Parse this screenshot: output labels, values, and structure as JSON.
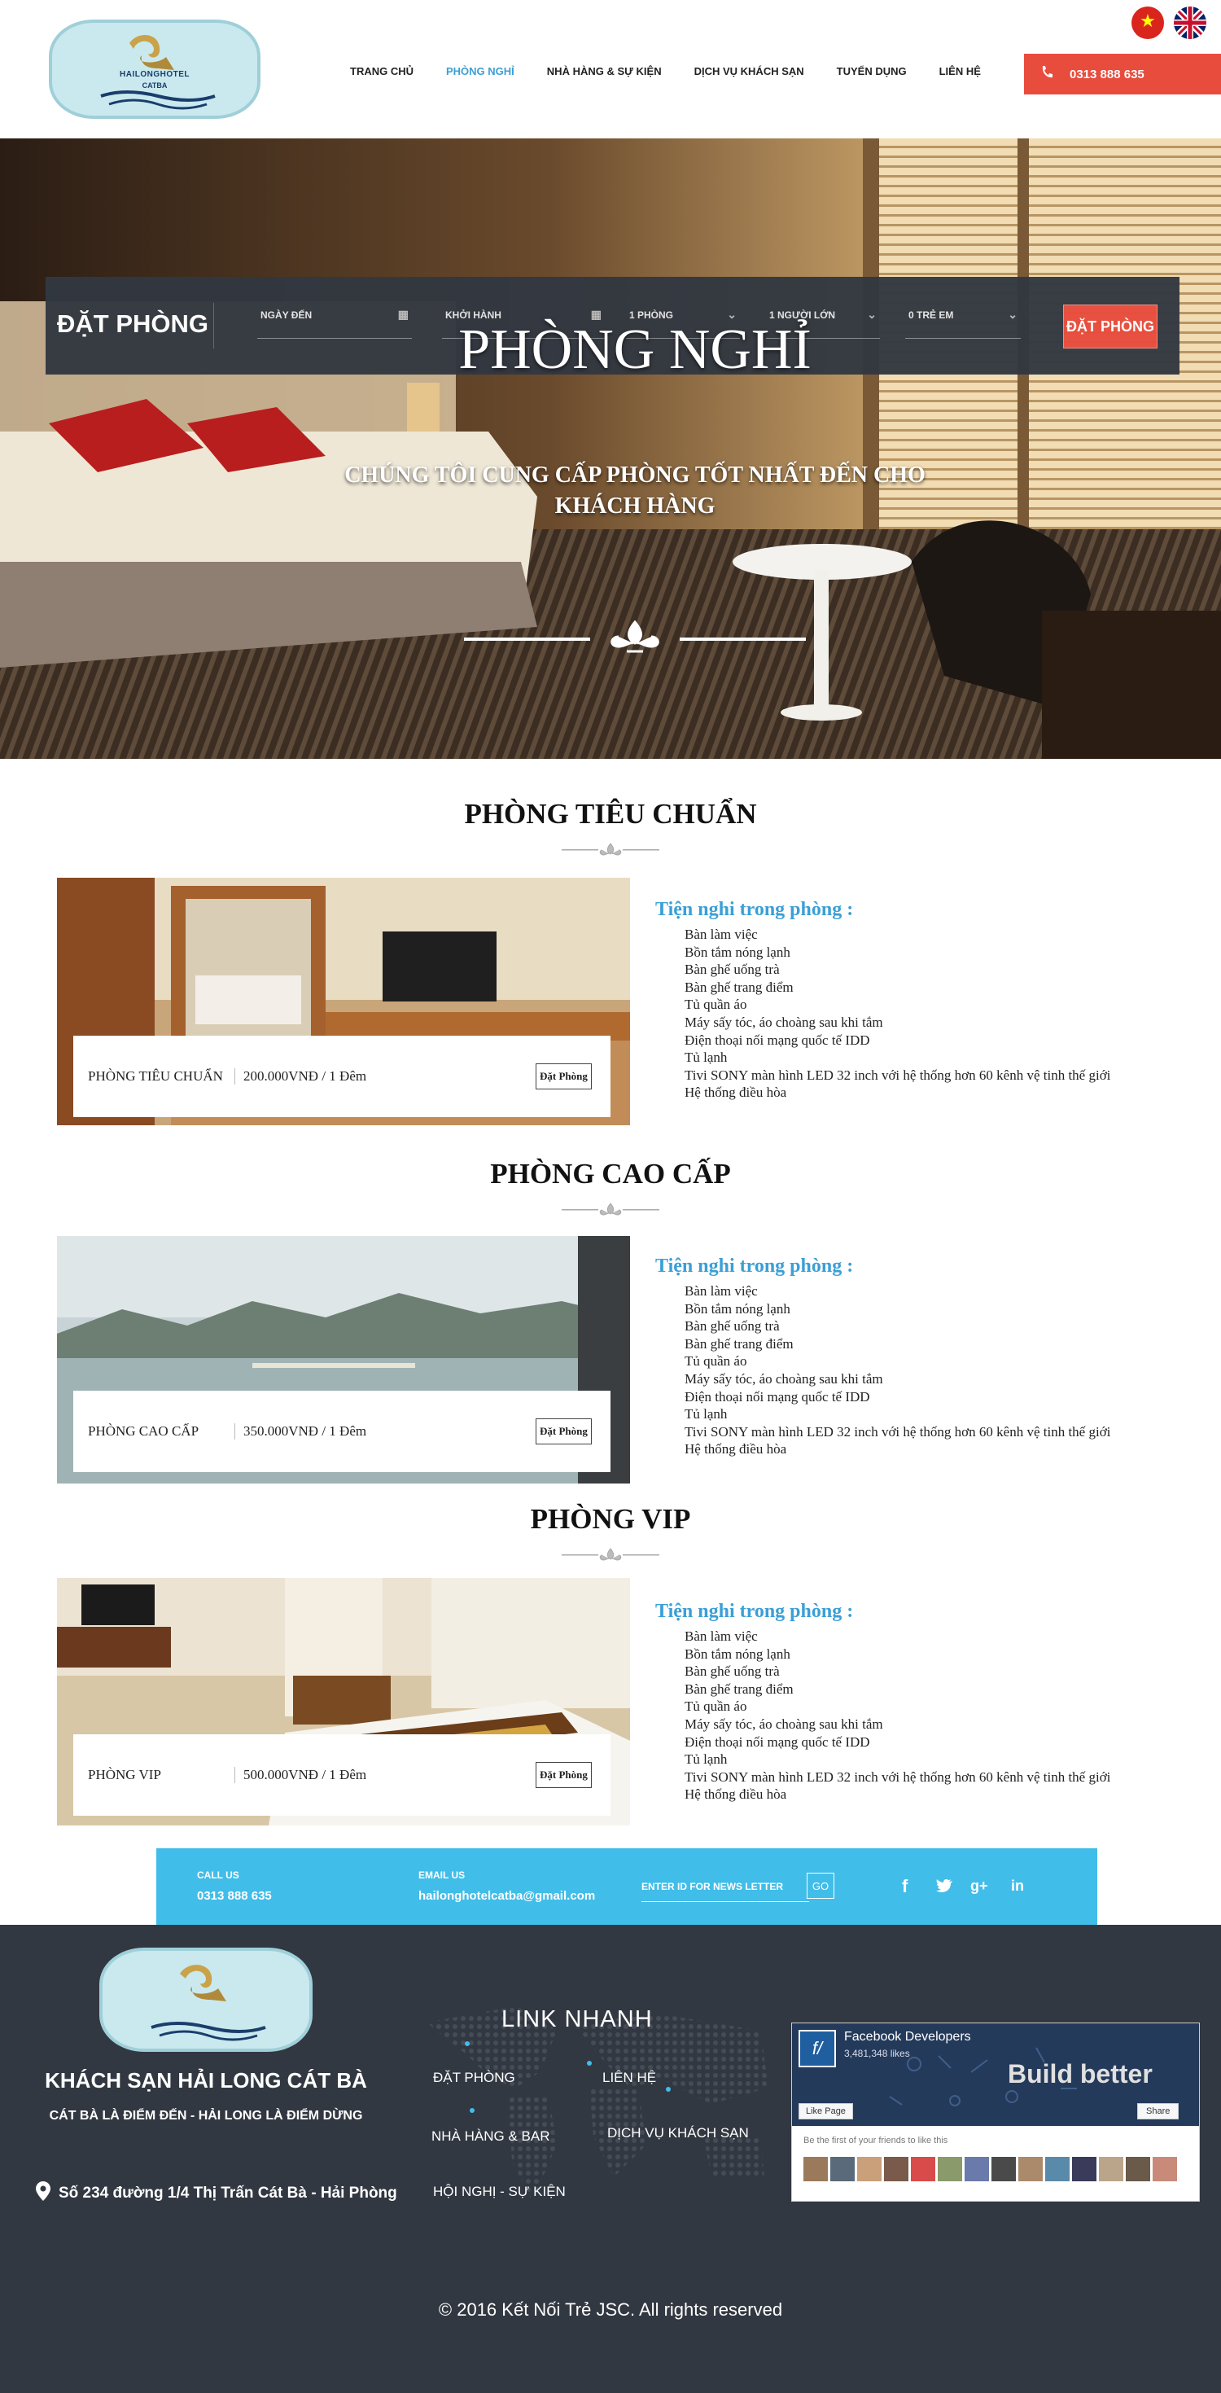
{
  "header": {
    "logo_text": "HAILONGHOTEL",
    "logo_sub": "CATBA",
    "nav": [
      "TRANG CHỦ",
      "PHÒNG NGHỈ",
      "NHÀ HÀNG & SỰ KIỆN",
      "DỊCH VỤ KHÁCH SẠN",
      "TUYỂN DỤNG",
      "LIÊN HỆ"
    ],
    "active_nav": "PHÒNG NGHỈ",
    "phone": "0313 888 635"
  },
  "booking": {
    "title": "ĐẶT PHÒNG",
    "checkin": "NGÀY ĐẾN",
    "checkout": "KHỞI HÀNH",
    "rooms": "1 PHÒNG",
    "adults": "1 NGƯỜI LỚN",
    "children": "0 TRẺ EM",
    "button": "ĐẶT PHÒNG"
  },
  "hero": {
    "title": "PHÒNG NGHỈ",
    "subtitle": "CHÚNG TÔI CUNG CẤP PHÒNG TỐT NHẤT ĐẾN CHO KHÁCH HÀNG"
  },
  "rooms": [
    {
      "title": "PHÒNG TIÊU CHUẨN",
      "name": "PHÒNG TIÊU CHUẨN",
      "price": "200.000VNĐ / 1 Đêm",
      "button": "Đặt Phòng"
    },
    {
      "title": "PHÒNG CAO CẤP",
      "name": "PHÒNG CAO CẤP",
      "price": "350.000VNĐ / 1 Đêm",
      "button": "Đặt Phòng"
    },
    {
      "title": "PHÒNG VIP",
      "name": "PHÒNG VIP",
      "price": "500.000VNĐ / 1 Đêm",
      "button": "Đặt Phòng"
    }
  ],
  "amenities": {
    "heading": "Tiện nghi trong phòng :",
    "items": [
      "Bàn làm việc",
      "Bồn tắm nóng lạnh",
      "Bàn ghế uống trà",
      "Bàn ghế trang điểm",
      "Tủ quần áo",
      "Máy sấy tóc, áo choàng sau khi tắm",
      "Điện thoại nối mạng quốc tế IDD",
      "Tủ lạnh",
      "Tivi SONY màn hình LED 32 inch với hệ thống hơn 60 kênh vệ tinh thế giới",
      "Hệ thống điều hòa"
    ]
  },
  "newsbar": {
    "call_label": "CALL US",
    "call_value": "0313 888 635",
    "email_label": "EMAIL US",
    "email_value": "hailonghotelcatba@gmail.com",
    "newsletter_placeholder": "ENTER ID  FOR NEWS LETTER",
    "go": "GO"
  },
  "footer": {
    "hotel_name": "KHÁCH SẠN HẢI LONG CÁT BÀ",
    "slogan": "CÁT BÀ LÀ ĐIỂM ĐẾN - HẢI LONG LÀ ĐIỂM DỪNG",
    "address": "Số 234 đường 1/4 Thị Trấn Cát Bà - Hải Phòng",
    "links_title": "LINK NHANH",
    "links": [
      "ĐẶT PHÒNG",
      "LIÊN HỆ",
      "NHÀ HÀNG & BAR",
      "DỊCH VỤ KHÁCH SẠN",
      "HỘI NGHỊ - SỰ KIỆN"
    ],
    "fb_name": "Facebook Developers",
    "fb_likes": "3,481,348 likes",
    "fb_banner": "Build better",
    "fb_like_btn": "Like Page",
    "fb_share_btn": "Share",
    "fb_friends": "Be the first of your friends to like this",
    "copyright": "© 2016 Kết Nối Trẻ JSC. All rights reserved"
  },
  "colors": {
    "accent": "#3b9fd6",
    "red": "#e84c3d",
    "dark": "#323841",
    "cyan": "#41bde9"
  }
}
